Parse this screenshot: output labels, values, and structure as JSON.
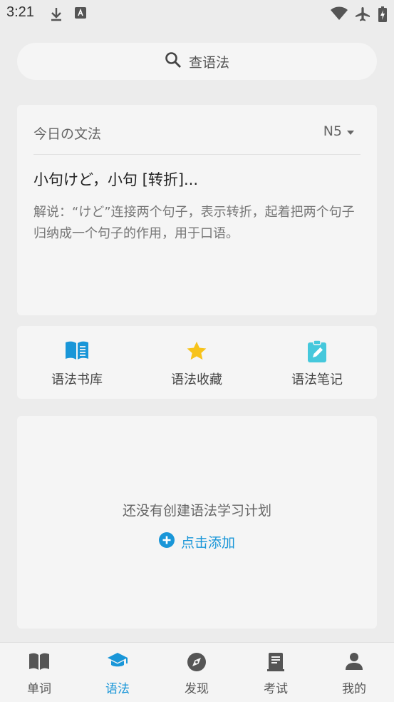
{
  "status_bar": {
    "time": "3:21",
    "left_icons": [
      "download-icon",
      "keyboard-icon"
    ],
    "right_icons": [
      "wifi-icon",
      "airplane-icon",
      "battery-icon"
    ]
  },
  "search": {
    "placeholder": "查语法",
    "icon": "search-icon"
  },
  "daily": {
    "title": "今日の文法",
    "level": "N5",
    "grammar_title": "小句けど，小句 [转折]...",
    "description": "解说：“けど”连接两个句子，表示转折，起着把两个句子归纳成一个句子的作用，用于口语。"
  },
  "shortcuts": [
    {
      "label": "语法书库",
      "icon": "book-icon",
      "color": "#1996d8"
    },
    {
      "label": "语法收藏",
      "icon": "star-icon",
      "color": "#f7c31b"
    },
    {
      "label": "语法笔记",
      "icon": "note-icon",
      "color": "#45c8dc"
    }
  ],
  "plan": {
    "empty_text": "还没有创建语法学习计划",
    "add_label": "点击添加",
    "accent": "#1996d8"
  },
  "tabs": [
    {
      "label": "单词",
      "icon": "book-icon",
      "active": false
    },
    {
      "label": "语法",
      "icon": "graduation-cap-icon",
      "active": true
    },
    {
      "label": "发现",
      "icon": "compass-icon",
      "active": false
    },
    {
      "label": "考试",
      "icon": "exam-icon",
      "active": false
    },
    {
      "label": "我的",
      "icon": "person-icon",
      "active": false
    }
  ]
}
